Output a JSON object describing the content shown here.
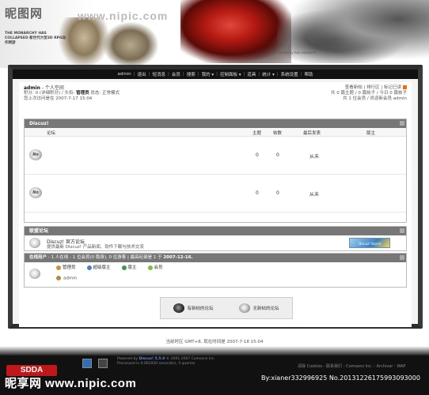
{
  "header": {
    "logo": "昵图网",
    "url": "www.nipic.com",
    "tagline": "THE MONARCHY HAS COLLAPSED  新世代大型3D RPG动作网游",
    "promo_text": "The monarchy has collapsed"
  },
  "nav": {
    "items": [
      "admin",
      "退出",
      "短消息",
      "会员",
      "搜索",
      "我的 ▾",
      "控制面板 ▾",
      "道具",
      "统计 ▾",
      "系统设置",
      "帮助"
    ]
  },
  "userinfo": {
    "name": "admin",
    "space": "个人空间",
    "credits_label": "积分: 0",
    "detail_label": "详细积分",
    "title_label": "头衔:",
    "title_value": "管理员",
    "status_label": "状态: 正常模式",
    "last_visit": "您上次访问是在 2007-7-17 15:04"
  },
  "rightinfo": {
    "links": "查看新帖 | 排行区 | 标记已读",
    "stats": "共 0 篇主题 / 0 篇帖子 / 今日 0 篇帖子",
    "members": "共 1 位会员 / 欢迎新会员 admin"
  },
  "category": {
    "title": "Discuz!",
    "columns": {
      "forum": "论坛",
      "topics": "主题",
      "posts": "帖数",
      "last": "最后发表",
      "mods": "版主"
    },
    "rows": [
      {
        "topics": "0",
        "posts": "0",
        "last": "从未"
      },
      {
        "topics": "0",
        "posts": "0",
        "last": "从未"
      }
    ]
  },
  "linked": {
    "title": "联盟论坛",
    "name": "Discuz! 官方论坛",
    "desc": "提供最新 Discuz! 产品新闻、软件下载与技术交流",
    "badge": "Discuz! Board"
  },
  "online": {
    "title": "在线用户",
    "summary": "- 1 人在线 - 1 位会员(0 隐身), 0 位游客 | 最高纪录是 1 于",
    "record_date": "2007-12-16.",
    "legend": [
      "管理员",
      "超级版主",
      "版主",
      "会员"
    ],
    "user": "admin"
  },
  "newlegend": {
    "new": "有新帖的论坛",
    "none": "无新帖的论坛"
  },
  "timeline": "当前时区 GMT+8, 现在时间是 2007-7-18 15:04",
  "footer": {
    "logo": "SDDA",
    "powered_by": "Powered by",
    "product": "Discuz! 5.5.0",
    "copyright": "© 2001-2007 Comsenz Inc.",
    "processed": "Processed in 0.061020 second(s), 5 queries",
    "links": "清除 Cookies  -  联系我们  -  Comsenz Inc.  -  Archiver  -  WAP",
    "watermark": "昵享网 www.nipic.com",
    "watermark_right": "By:xianer332996925  No.20131226175993093000"
  },
  "colors": {
    "nav_bg": "#111111",
    "head_bg": "#777777",
    "footer_bg": "#111111",
    "brand_red": "#c0181a"
  }
}
